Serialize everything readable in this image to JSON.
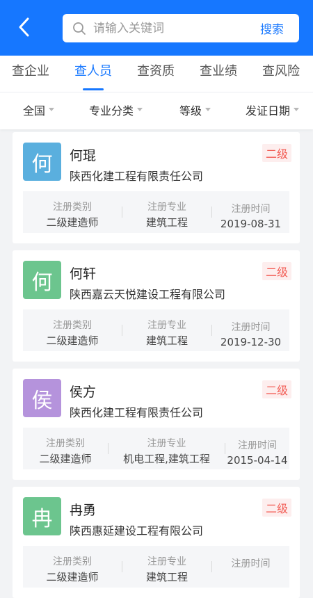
{
  "header": {
    "search_placeholder": "请输入关键词",
    "search_button": "搜索"
  },
  "tabs": [
    {
      "label": "查企业",
      "active": false
    },
    {
      "label": "查人员",
      "active": true
    },
    {
      "label": "查资质",
      "active": false
    },
    {
      "label": "查业绩",
      "active": false
    },
    {
      "label": "查风险",
      "active": false
    }
  ],
  "filters": [
    {
      "label": "全国"
    },
    {
      "label": "专业分类"
    },
    {
      "label": "等级"
    },
    {
      "label": "发证日期"
    }
  ],
  "info_labels": {
    "category": "注册类别",
    "major": "注册专业",
    "date": "注册时间"
  },
  "people": [
    {
      "avatar_char": "何",
      "avatar_color": "#5aafde",
      "name": "何琨",
      "company": "陕西化建工程有限责任公司",
      "level": "二级",
      "category": "二级建造师",
      "major": "建筑工程",
      "date": "2019-08-31"
    },
    {
      "avatar_char": "何",
      "avatar_color": "#6cc58e",
      "name": "何轩",
      "company": "陕西嘉云天悦建设工程有限公司",
      "level": "二级",
      "category": "二级建造师",
      "major": "建筑工程",
      "date": "2019-12-30"
    },
    {
      "avatar_char": "侯",
      "avatar_color": "#b593dc",
      "name": "侯方",
      "company": "陕西化建工程有限责任公司",
      "level": "二级",
      "category": "二级建造师",
      "major": "机电工程,建筑工程",
      "date": "2015-04-14"
    },
    {
      "avatar_char": "冉",
      "avatar_color": "#6cc58e",
      "name": "冉勇",
      "company": "陕西惠延建设工程有限公司",
      "level": "二级",
      "category": "二级建造师",
      "major": "建筑工程",
      "date": ""
    }
  ]
}
